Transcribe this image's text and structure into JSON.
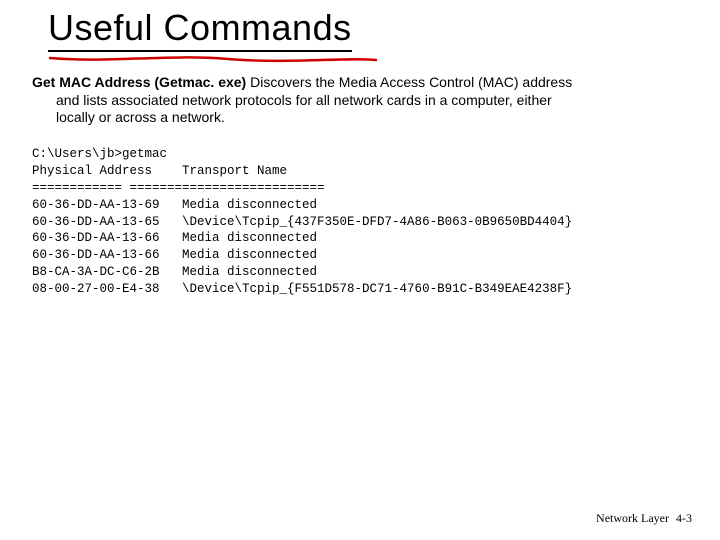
{
  "title": "Useful Commands",
  "intro": {
    "lead": "Get MAC Address (Getmac. exe)",
    "rest_line1": " Discovers the Media Access Control (MAC) address",
    "rest_line2": "and lists associated network protocols for all network cards in a computer, either",
    "rest_line3": "locally or across a network."
  },
  "terminal": {
    "prompt": "C:\\Users\\jb>getmac",
    "header": "Physical Address    Transport Name",
    "divider": "============ ==========================",
    "rows": [
      {
        "mac": "60-36-DD-AA-13-69",
        "tn": "Media disconnected"
      },
      {
        "mac": "60-36-DD-AA-13-65",
        "tn": "\\Device\\Tcpip_{437F350E-DFD7-4A86-B063-0B9650BD4404}"
      },
      {
        "mac": "60-36-DD-AA-13-66",
        "tn": "Media disconnected"
      },
      {
        "mac": "60-36-DD-AA-13-66",
        "tn": "Media disconnected"
      },
      {
        "mac": "B8-CA-3A-DC-C6-2B",
        "tn": "Media disconnected"
      },
      {
        "mac": "08-00-27-00-E4-38",
        "tn": "\\Device\\Tcpip_{F551D578-DC71-4760-B91C-B349EAE4238F}"
      }
    ]
  },
  "footer": {
    "section": "Network Layer",
    "page": "4-3"
  }
}
